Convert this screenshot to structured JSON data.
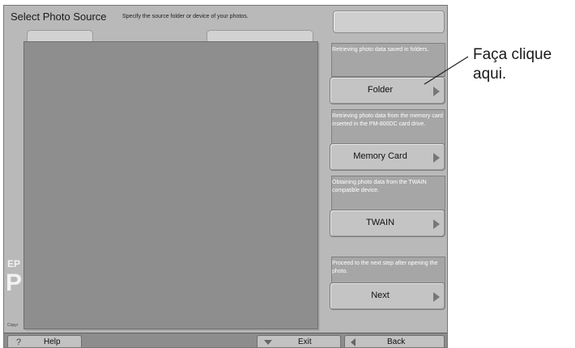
{
  "header": {
    "title": "Select Photo Source",
    "subtitle": "Specify the source folder or device of your photos."
  },
  "brand": {
    "small": "EP",
    "big": "P"
  },
  "footer": {
    "copyright": "Copyr"
  },
  "sources": [
    {
      "description": "Retrieving photo data saved in folders.",
      "button_label": "Folder"
    },
    {
      "description": "Retrieving photo data from the memory card inserted in the PM-800DC card drive.",
      "button_label": "Memory Card"
    },
    {
      "description": "Obtaining photo data from the TWAIN compatible device.",
      "button_label": "TWAIN"
    },
    {
      "description": "Proceed to the next step after opening the photo.",
      "button_label": "Next"
    }
  ],
  "bottom_bar": {
    "help_label": "Help",
    "exit_label": "Exit",
    "back_label": "Back"
  },
  "annotation": {
    "callout_line1": "Faça clique",
    "callout_line2": "aqui."
  },
  "icons": {
    "button_arrow": "arrow-right-icon",
    "help": "question-icon",
    "exit": "triangle-down-icon",
    "back": "triangle-left-icon"
  }
}
